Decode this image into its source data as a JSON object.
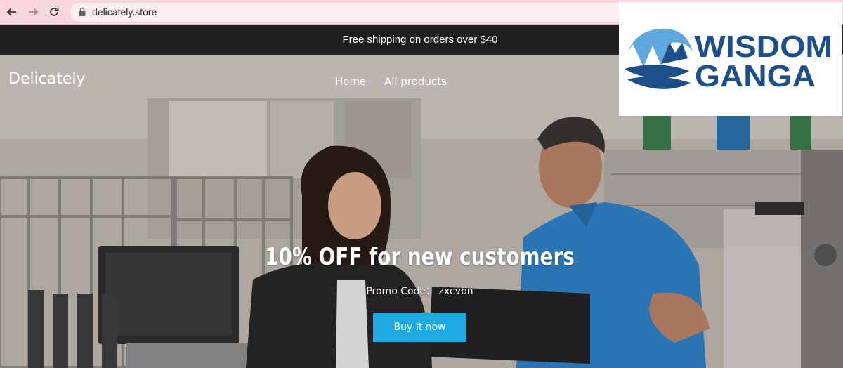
{
  "browser": {
    "url": "delicately.store"
  },
  "announcement": {
    "text": "Free shipping on orders over $40"
  },
  "header": {
    "site_title": "Delicately",
    "nav": [
      "Home",
      "All products"
    ]
  },
  "hero": {
    "headline": "10% OFF for new customers",
    "promo_text": "Promo Code： zxcvbn",
    "button_label": "Buy it now"
  },
  "logo": {
    "line1": "WISDOM",
    "line2": "GANGA"
  },
  "colors": {
    "chrome_bg": "#f7d6dc",
    "announcement_bg": "#1f1f1f",
    "button": "#1fa9e1",
    "logo_blue": "#1d4f8a",
    "logo_light_blue": "#5fa8de"
  },
  "icons": [
    "back-arrow-icon",
    "forward-arrow-icon",
    "reload-icon",
    "lock-icon"
  ]
}
